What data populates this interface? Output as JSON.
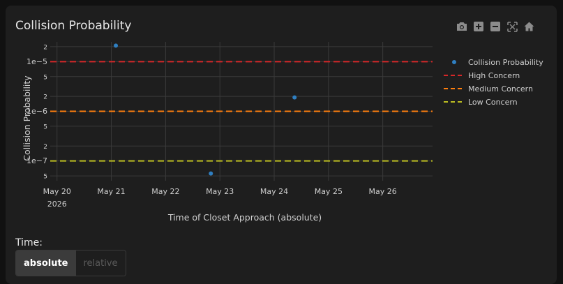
{
  "title": "Collision Probability",
  "modebar": [
    {
      "name": "camera-icon",
      "label": "Download plot as a png"
    },
    {
      "name": "zoom-in-icon",
      "label": "Zoom in"
    },
    {
      "name": "zoom-out-icon",
      "label": "Zoom out"
    },
    {
      "name": "autoscale-icon",
      "label": "Autoscale"
    },
    {
      "name": "home-icon",
      "label": "Reset axes"
    }
  ],
  "chart_data": {
    "type": "scatter",
    "title": "",
    "xlabel": "Time of Closet Approach (absolute)",
    "ylabel": "Collision Probability",
    "y_scale": "log",
    "ylim": [
      4e-08,
      2.5e-05
    ],
    "xlim": [
      "2026-05-19T21:00",
      "2026-05-26T22:00"
    ],
    "grid": true,
    "legend_position": "right",
    "x_ticks": [
      {
        "value": "2026-05-20",
        "label": "May 20",
        "sublabel": "2026"
      },
      {
        "value": "2026-05-21",
        "label": "May 21",
        "sublabel": ""
      },
      {
        "value": "2026-05-22",
        "label": "May 22",
        "sublabel": ""
      },
      {
        "value": "2026-05-23",
        "label": "May 23",
        "sublabel": ""
      },
      {
        "value": "2026-05-24",
        "label": "May 24",
        "sublabel": ""
      },
      {
        "value": "2026-05-25",
        "label": "May 25",
        "sublabel": ""
      },
      {
        "value": "2026-05-26",
        "label": "May 26",
        "sublabel": ""
      }
    ],
    "y_ticks": [
      {
        "value": 5e-08,
        "label": "5"
      },
      {
        "value": 1e-07,
        "label": "1e−7"
      },
      {
        "value": 2e-07,
        "label": "2"
      },
      {
        "value": 5e-07,
        "label": "5"
      },
      {
        "value": 1e-06,
        "label": "1e−6"
      },
      {
        "value": 2e-06,
        "label": "2"
      },
      {
        "value": 5e-06,
        "label": "5"
      },
      {
        "value": 1e-05,
        "label": "1e−5"
      },
      {
        "value": 2e-05,
        "label": "2"
      }
    ],
    "series": [
      {
        "name": "Collision Probability",
        "kind": "markers",
        "color": "#2f7fc1",
        "points": [
          {
            "x": "2026-05-21T02:00",
            "y": 2.1e-05
          },
          {
            "x": "2026-05-22T20:00",
            "y": 5.6e-08
          },
          {
            "x": "2026-05-24T09:00",
            "y": 1.9e-06
          }
        ]
      },
      {
        "name": "High Concern",
        "kind": "hline",
        "y": 1e-05,
        "color": "#d62728"
      },
      {
        "name": "Medium Concern",
        "kind": "hline",
        "y": 1e-06,
        "color": "#ff7f0e"
      },
      {
        "name": "Low Concern",
        "kind": "hline",
        "y": 1e-07,
        "color": "#bcbd22"
      }
    ]
  },
  "time_selector": {
    "label": "Time:",
    "options": [
      "absolute",
      "relative"
    ],
    "selected": "absolute"
  }
}
